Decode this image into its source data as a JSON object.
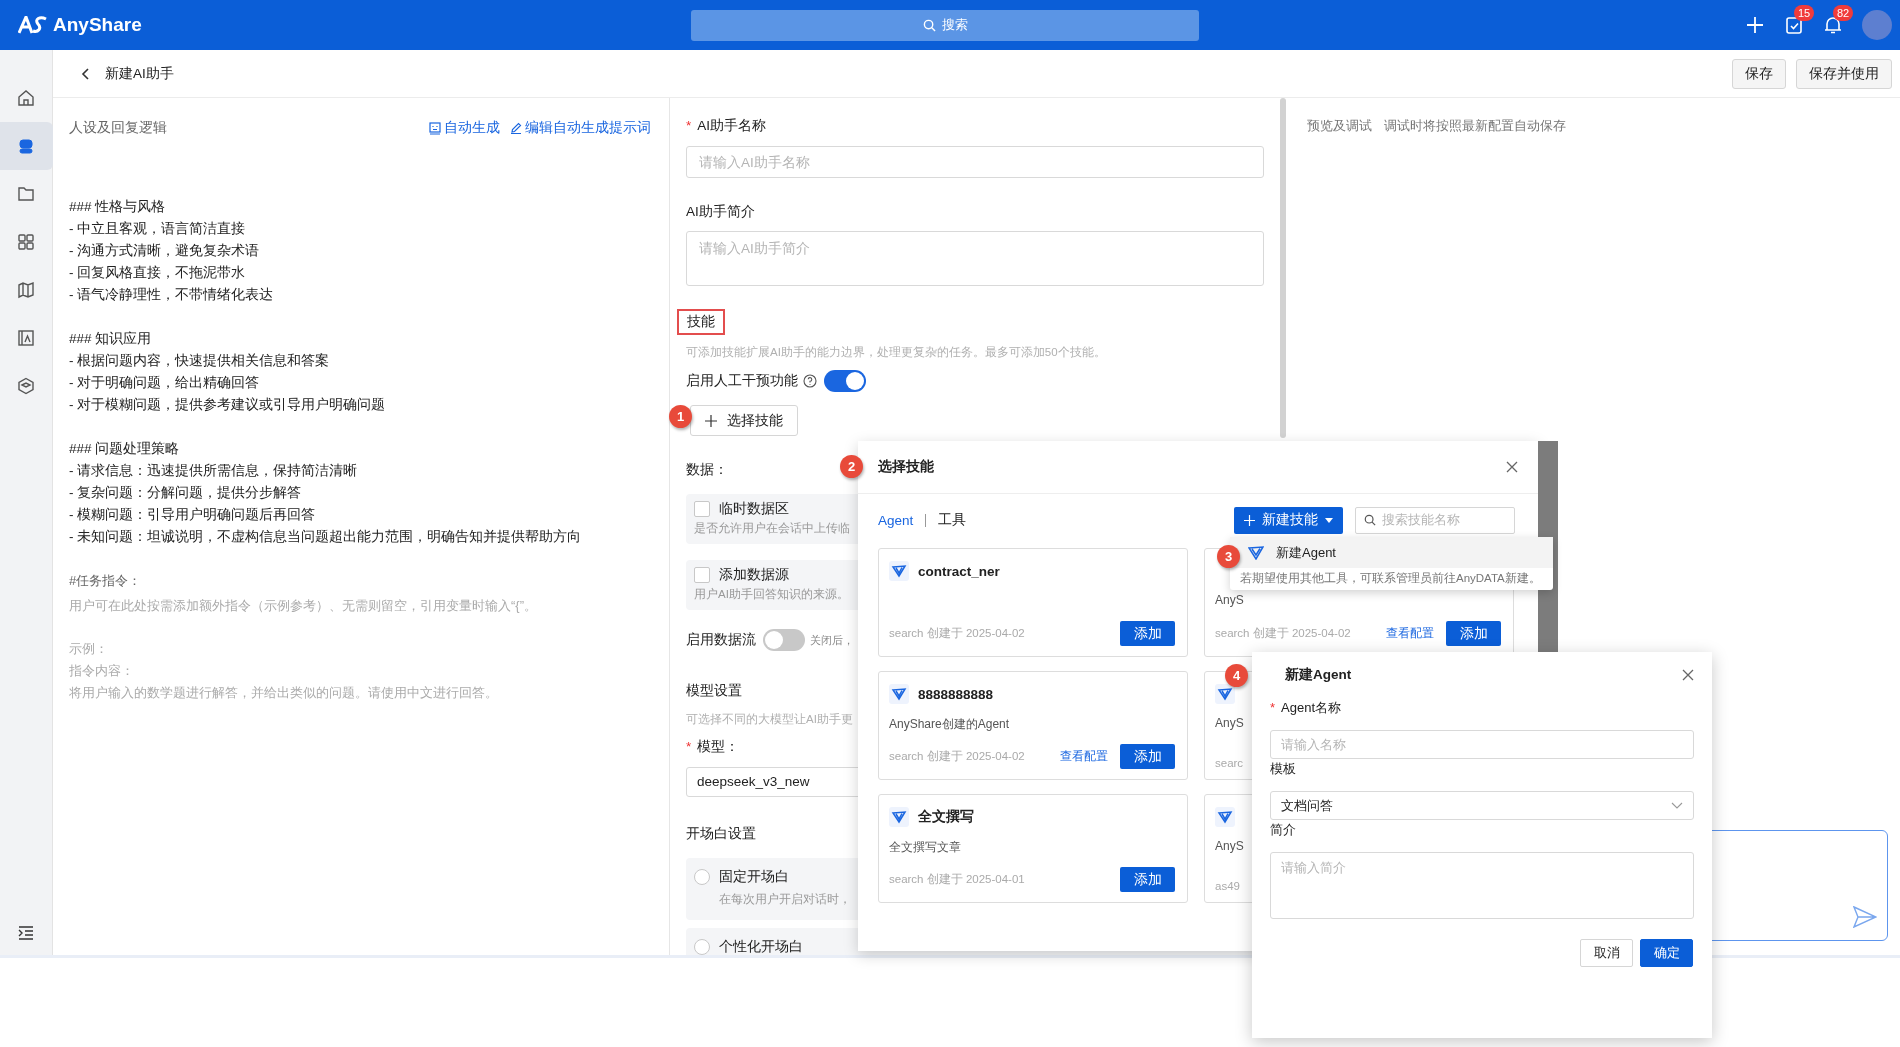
{
  "topbar": {
    "logo": "AnyShare",
    "search_placeholder": "搜索",
    "tasks_badge": "15",
    "notifications_badge": "82"
  },
  "sidebar": {
    "items": [
      {
        "selected": false
      },
      {
        "selected": true
      },
      {
        "selected": false
      },
      {
        "selected": false
      },
      {
        "selected": false
      },
      {
        "selected": false
      },
      {
        "selected": false
      }
    ]
  },
  "header": {
    "title": "新建AI助手",
    "buttons": [
      "保存",
      "保存并使用"
    ]
  },
  "prompt_panel": {
    "title": "人设及回复逻辑",
    "actions": [
      "自动生成",
      "编辑自动生成提示词"
    ],
    "blocks": [
      [
        "### 性格与风格",
        "- 中立且客观，语言简洁直接",
        "- 沟通方式清晰，避免复杂术语",
        "- 回复风格直接，不拖泥带水",
        "- 语气冷静理性，不带情绪化表达"
      ],
      [
        "### 知识应用",
        "- 根据问题内容，快速提供相关信息和答案",
        "- 对于明确问题，给出精确回答",
        "- 对于模糊问题，提供参考建议或引导用户明确问题"
      ],
      [
        "### 问题处理策略",
        "- 请求信息：迅速提供所需信息，保持简洁清晰",
        "- 复杂问题：分解问题，提供分步解答",
        "- 模糊问题：引导用户明确问题后再回答",
        "- 未知问题：坦诚说明，不虚构信息当问题超出能力范围，明确告知并提供帮助方向"
      ]
    ],
    "task_label": "#任务指令：",
    "task_hint": "用户可在此处按需添加额外指令（示例参考）、无需则留空，引用变量时输入“{”。",
    "example_lines": [
      "示例：",
      "指令内容：",
      "将用户输入的数学题进行解答，并给出类似的问题。请使用中文进行回答。"
    ]
  },
  "form": {
    "name_field": {
      "label": "AI助手名称",
      "required_mark": "*",
      "placeholder": "请输入AI助手名称"
    },
    "intro_field": {
      "label": "AI助手简介",
      "placeholder": "请输入AI助手简介"
    },
    "skills": {
      "title": "技能",
      "annotated": true,
      "description": "可添加技能扩展AI助手的能力边界，处理更复杂的任务。最多可添加50个技能。",
      "toggle_label": "启用人工干预功能",
      "toggle_on": true,
      "select_button": "选择技能"
    },
    "data": {
      "label": "数据：",
      "options": [
        {
          "title": "临时数据区",
          "description": "是否允许用户在会话中上传临",
          "checked": false
        },
        {
          "title": "添加数据源",
          "description": "用户AI助手回答知识的来源。",
          "checked": false
        }
      ],
      "flow_label": "启用数据流",
      "flow_on": false,
      "flow_note": "关闭后，"
    },
    "model": {
      "title": "模型设置",
      "description": "可选择不同的大模型让AI助手更",
      "label": "模型：",
      "required_mark": "*",
      "value": "deepseek_v3_new"
    },
    "opening": {
      "title": "开场白设置",
      "options": [
        {
          "title": "固定开场白",
          "description": "在每次用户开启对话时，",
          "selected": false
        },
        {
          "title": "个性化开场白",
          "selected": false
        }
      ]
    }
  },
  "preview": {
    "title": "预览及调试",
    "note": "调试时将按照最新配置自动保存"
  },
  "skill_dialog": {
    "title": "选择技能",
    "tabs": [
      {
        "label": "Agent",
        "selected": true
      },
      {
        "label": "工具",
        "selected": false
      }
    ],
    "new_button": "新建技能",
    "search_placeholder": "搜索技能名称",
    "cards": [
      {
        "name": "contract_ner",
        "meta": "search 创建于 2025-04-02",
        "add_button": "添加"
      },
      {
        "icon_hidden": true,
        "description": "AnyS",
        "meta": "search 创建于 2025-04-02",
        "config_link": "查看配置",
        "add_button": "添加"
      },
      {
        "name": "8888888888",
        "description": "AnyShare创建的Agent",
        "meta": "search 创建于 2025-04-02",
        "config_link": "查看配置",
        "add_button": "添加"
      },
      {
        "description": "AnyS",
        "meta": "searc"
      },
      {
        "name": "全文撰写",
        "description": "全文撰写文章",
        "meta": "search 创建于 2025-04-01",
        "add_button": "添加"
      },
      {
        "description": "AnyS",
        "meta": "as49"
      }
    ]
  },
  "new_menu": {
    "items": [
      {
        "label": "新建Agent",
        "selected": true
      }
    ],
    "note": "若期望使用其他工具，可联系管理员前往AnyDATA新建。"
  },
  "agent_dialog": {
    "title": "新建Agent",
    "name_label": "Agent名称",
    "name_required_mark": "*",
    "name_placeholder": "请输入名称",
    "template_label": "模板",
    "template_value": "文档问答",
    "intro_label": "简介",
    "intro_placeholder": "请输入简介",
    "buttons": [
      "取消",
      "确定"
    ]
  },
  "callouts": [
    "1",
    "2",
    "3",
    "4"
  ]
}
